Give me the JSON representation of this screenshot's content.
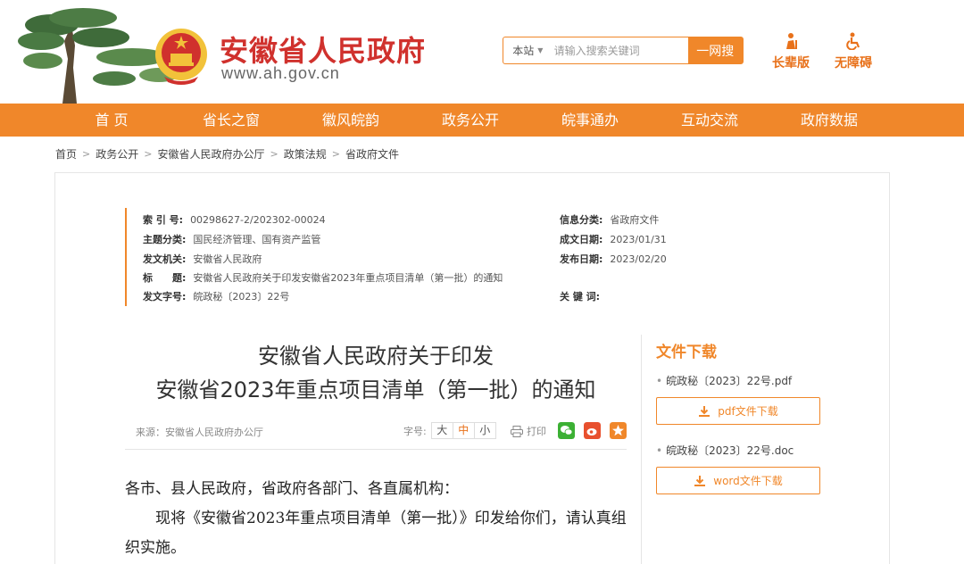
{
  "header": {
    "site_title": "安徽省人民政府",
    "site_url": "www.ah.gov.cn",
    "search": {
      "scope": "本站",
      "placeholder": "请输入搜索关键词",
      "button": "一网搜"
    },
    "tools": [
      {
        "label": "长辈版",
        "icon": "elder-icon"
      },
      {
        "label": "无障碍",
        "icon": "accessibility-icon"
      }
    ],
    "brand_color": "#f0872a",
    "title_color": "#d0312d"
  },
  "nav": [
    "首 页",
    "省长之窗",
    "徽风皖韵",
    "政务公开",
    "皖事通办",
    "互动交流",
    "政府数据"
  ],
  "breadcrumb": [
    "首页",
    "政务公开",
    "安徽省人民政府办公厅",
    "政策法规",
    "省政府文件"
  ],
  "meta": {
    "index_no": {
      "label": "索 引 号:",
      "value": "00298627-2/202302-00024"
    },
    "topic": {
      "label": "主题分类:",
      "value": "国民经济管理、国有资产监管"
    },
    "issuer": {
      "label": "发文机关:",
      "value": "安徽省人民政府"
    },
    "title": {
      "label": "标　　题:",
      "value": "安徽省人民政府关于印发安徽省2023年重点项目清单（第一批）的通知"
    },
    "doc_no": {
      "label": "发文字号:",
      "value": "皖政秘〔2023〕22号"
    },
    "info_category": {
      "label": "信息分类:",
      "value": "省政府文件"
    },
    "written_date": {
      "label": "成文日期:",
      "value": "2023/01/31"
    },
    "publish_date": {
      "label": "发布日期:",
      "value": "2023/02/20"
    },
    "keywords": {
      "label": "关 键 词:",
      "value": ""
    }
  },
  "article": {
    "title_line1": "安徽省人民政府关于印发",
    "title_line2": "安徽省2023年重点项目清单（第一批）的通知",
    "source": "来源：安徽省人民政府办公厅",
    "font_size_label": "字号:",
    "font_sizes": [
      "大",
      "中",
      "小"
    ],
    "print_label": "打印",
    "share": [
      "wechat-icon",
      "weibo-icon",
      "favorite-icon"
    ],
    "salutation": "各市、县人民政府，省政府各部门、各直属机构：",
    "paragraph1": "现将《安徽省2023年重点项目清单（第一批）》印发给你们，请认真组织实施。"
  },
  "downloads": {
    "title": "文件下载",
    "files": [
      {
        "name": "皖政秘〔2023〕22号.pdf",
        "button": "pdf文件下载"
      },
      {
        "name": "皖政秘〔2023〕22号.doc",
        "button": "word文件下载"
      }
    ]
  }
}
